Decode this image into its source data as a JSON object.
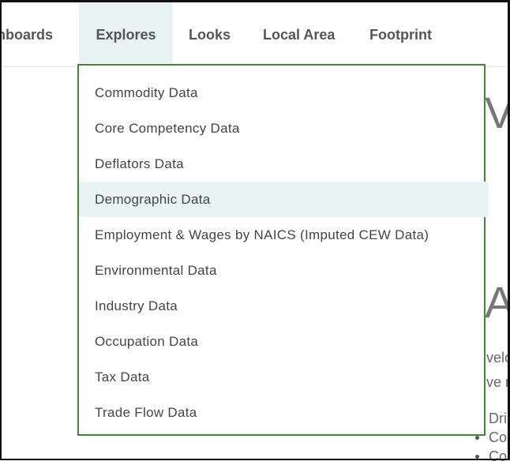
{
  "nav": {
    "items": [
      {
        "label": "hboards"
      },
      {
        "label": "Explores"
      },
      {
        "label": "Looks"
      },
      {
        "label": "Local Area"
      },
      {
        "label": "Footprint"
      }
    ]
  },
  "dropdown": {
    "items": [
      {
        "label": "Commodity Data"
      },
      {
        "label": "Core Competency Data"
      },
      {
        "label": "Deflators Data"
      },
      {
        "label": "Demographic Data"
      },
      {
        "label": "Employment & Wages by NAICS (Imputed CEW Data)"
      },
      {
        "label": "Environmental Data"
      },
      {
        "label": "Industry Data"
      },
      {
        "label": "Occupation Data"
      },
      {
        "label": "Tax Data"
      },
      {
        "label": "Trade Flow Data"
      }
    ],
    "hovered_index": 3,
    "border_color": "#3c8a2e",
    "hover_color": "#e9f3f3"
  },
  "background_page": {
    "heading_1": "V",
    "heading_2": "A",
    "line_1": "velo",
    "line_2": "ve n",
    "bullet_1": "Dri",
    "bullet_2": "Co",
    "bullet_3": "Co"
  }
}
